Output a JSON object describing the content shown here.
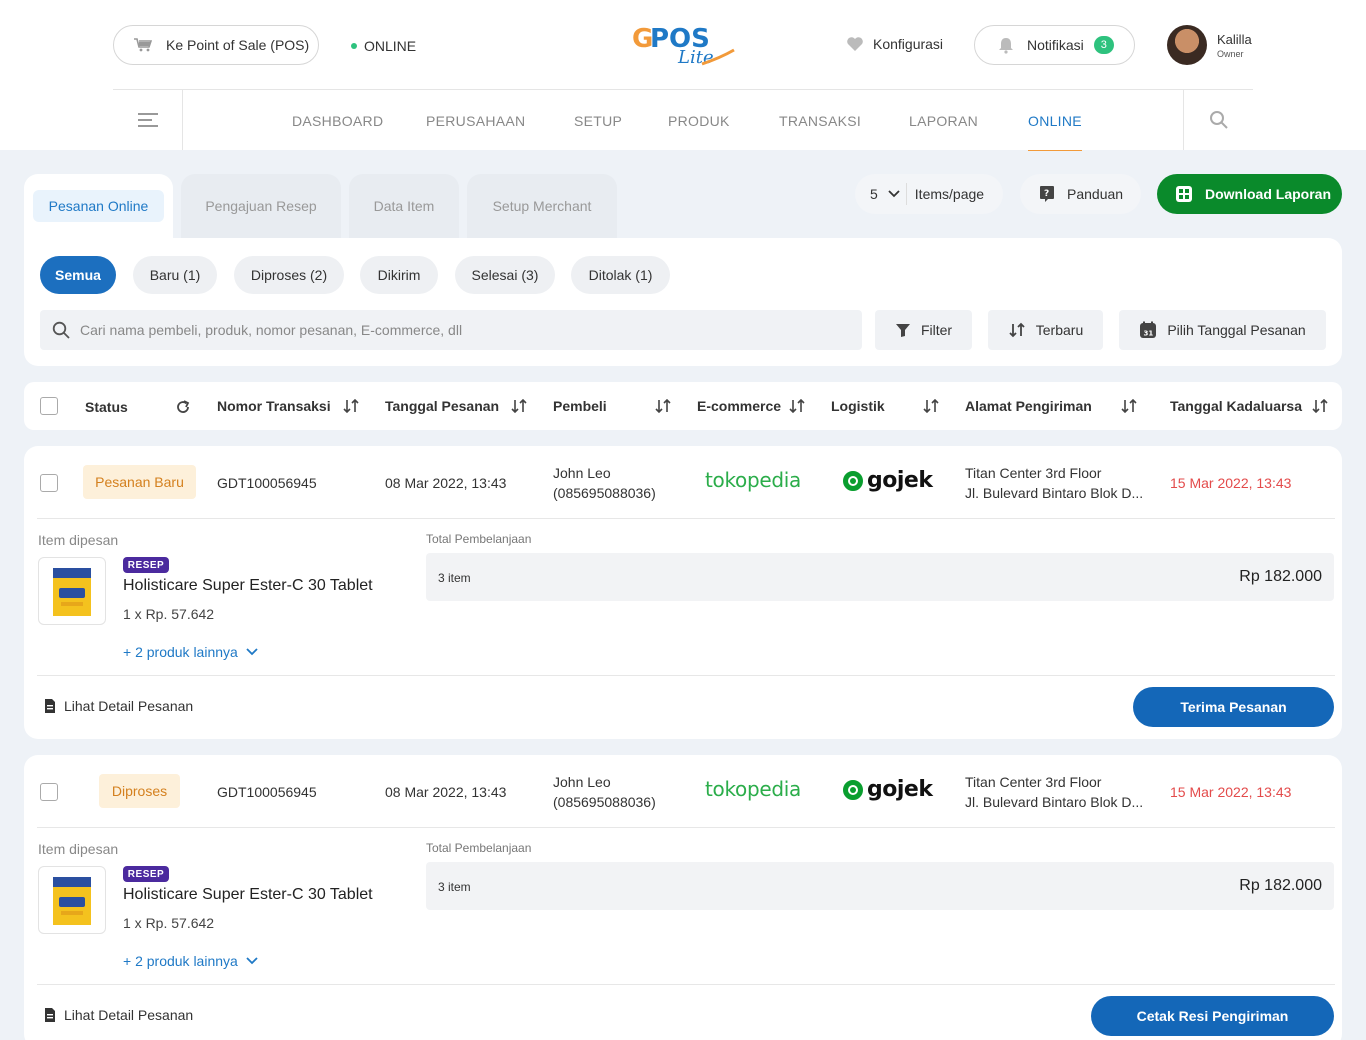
{
  "header": {
    "pos_label": "Ke Point of Sale (POS)",
    "online_label": "ONLINE",
    "logo_text": "GPOS",
    "logo_sub": "Lite",
    "config_label": "Konfigurasi",
    "notif_label": "Notifikasi",
    "notif_count": "3",
    "user_name": "Kalilla",
    "user_role": "Owner"
  },
  "nav": {
    "items": [
      "DASHBOARD",
      "PERUSAHAAN",
      "SETUP",
      "PRODUK",
      "TRANSAKSI",
      "LAPORAN",
      "ONLINE"
    ],
    "active": "ONLINE"
  },
  "tabs": [
    "Pesanan Online",
    "Pengajuan Resep",
    "Data Item",
    "Setup Merchant"
  ],
  "toolbar": {
    "per_page": "5",
    "per_page_label": "Items/page",
    "guide_label": "Panduan",
    "download_label": "Download Laporan"
  },
  "filters": {
    "chips": [
      "Semua",
      "Baru (1)",
      "Diproses (2)",
      "Dikirim",
      "Selesai (3)",
      "Ditolak (1)"
    ],
    "search_placeholder": "Cari nama pembeli, produk, nomor pesanan, E-commerce, dll",
    "filter_label": "Filter",
    "sort_label": "Terbaru",
    "date_label": "Pilih Tanggal Pesanan"
  },
  "table_headers": [
    "Status",
    "Nomor Transaksi",
    "Tanggal Pesanan",
    "Pembeli",
    "E-commerce",
    "Logistik",
    "Alamat Pengiriman",
    "Tanggal Kadaluarsa"
  ],
  "orders": [
    {
      "status": "Pesanan Baru",
      "number": "GDT100056945",
      "date": "08 Mar 2022, 13:43",
      "buyer_name": "John Leo",
      "buyer_phone": "(085695088036)",
      "ecommerce": "tokopedia",
      "logistics": "gojek",
      "address_1": "Titan Center 3rd Floor",
      "address_2": "Jl. Bulevard Bintaro Blok D...",
      "expiry": "15 Mar 2022, 13:43",
      "items_label": "Item dipesan",
      "badge": "RESEP",
      "product": "Holisticare Super Ester-C 30 Tablet",
      "price": "1 x Rp. 57.642",
      "more": "+ 2 produk lainnya",
      "total_label": "Total Pembelanjaan",
      "item_count": "3 item",
      "total": "Rp 182.000",
      "detail_label": "Lihat Detail Pesanan",
      "action": "Terima Pesanan"
    },
    {
      "status": "Diproses",
      "number": "GDT100056945",
      "date": "08 Mar 2022, 13:43",
      "buyer_name": "John Leo",
      "buyer_phone": "(085695088036)",
      "ecommerce": "tokopedia",
      "logistics": "gojek",
      "address_1": "Titan Center 3rd Floor",
      "address_2": "Jl. Bulevard Bintaro Blok D...",
      "expiry": "15 Mar 2022, 13:43",
      "items_label": "Item dipesan",
      "badge": "RESEP",
      "product": "Holisticare Super Ester-C 30 Tablet",
      "price": "1 x Rp. 57.642",
      "more": "+ 2 produk lainnya",
      "total_label": "Total Pembelanjaan",
      "item_count": "3 item",
      "total": "Rp 182.000",
      "detail_label": "Lihat Detail Pesanan",
      "action": "Cetak Resi Pengiriman"
    }
  ],
  "colors": {
    "primary": "#1467b8",
    "download": "#0a8a2b",
    "status_bg": "#fdf0da",
    "status_text": "#d4801e",
    "expiry": "#e34b4b",
    "online_dot": "#2ec27e",
    "badge_resep": "#4b2a9e"
  }
}
